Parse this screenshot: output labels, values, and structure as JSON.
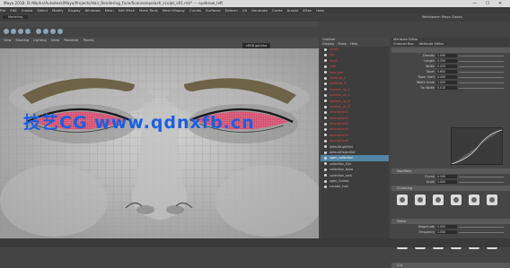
{
  "window": {
    "title": "Maya 2018: D:/Works/Autodesk/Maya/Projects/Hair_Rendering_Face/Scenes/eyelash_sculpt_v01.mb* --- eyebrow_left",
    "min": "—",
    "max": "☐",
    "close": "✕"
  },
  "menu": [
    "File",
    "Edit",
    "Create",
    "Select",
    "Modify",
    "Display",
    "Windows",
    "Mesh",
    "Edit Mesh",
    "Mesh Tools",
    "Mesh Display",
    "Curves",
    "Surfaces",
    "Deform",
    "UV",
    "Generate",
    "Cache",
    "Arnold",
    "XGen",
    "Help"
  ],
  "status": {
    "mode": "Modeling",
    "workspace": "Workspace: Maya Classic"
  },
  "viewport": {
    "menu": [
      "View",
      "Shading",
      "Lighting",
      "Show",
      "Renderer",
      "Panels"
    ],
    "camera_label": "sRGB gamma"
  },
  "outliner": {
    "title": "Outliner",
    "menu": [
      "Display",
      "Show",
      "Help"
    ],
    "items": [
      {
        "label": "persp",
        "color": "red"
      },
      {
        "label": "top",
        "color": "red"
      },
      {
        "label": "front",
        "color": "red"
      },
      {
        "label": "side",
        "color": "red"
      },
      {
        "label": "face_geo",
        "color": "red"
      },
      {
        "label": "eyebrow_L",
        "color": "red"
      },
      {
        "label": "eyebrow_R",
        "color": "red"
      },
      {
        "label": "eyelash_up_L",
        "color": "red"
      },
      {
        "label": "eyelash_dn_L",
        "color": "red"
      },
      {
        "label": "eyelash_up_R",
        "color": "red"
      },
      {
        "label": "eyelash_dn_R",
        "color": "red"
      },
      {
        "label": "description1",
        "color": "red"
      },
      {
        "label": "description2",
        "color": "red"
      },
      {
        "label": "description3",
        "color": "red"
      },
      {
        "label": "description4",
        "color": "red"
      },
      {
        "label": "description5",
        "color": "red"
      },
      {
        "label": "description6",
        "color": "red"
      },
      {
        "label": "defaultLightSet",
        "color": "none"
      },
      {
        "label": "defaultObjectSet",
        "color": "none"
      },
      {
        "label": "xgen_collection",
        "color": "sel"
      },
      {
        "label": "collection_Eye",
        "color": "none"
      },
      {
        "label": "collection_brow",
        "color": "none"
      },
      {
        "label": "collection_lash",
        "color": "none"
      },
      {
        "label": "xgen_Guides",
        "color": "none"
      },
      {
        "label": "Locator_hair",
        "color": "none"
      }
    ]
  },
  "attributes": {
    "title": "Attribute Editor",
    "tabs": [
      "Channel Box",
      "Attribute Editor"
    ],
    "rows": [
      {
        "label": "Density",
        "value": "1.000"
      },
      {
        "label": "Length",
        "value": "0.350"
      },
      {
        "label": "Width",
        "value": "0.020"
      },
      {
        "label": "Taper",
        "value": "0.600"
      },
      {
        "label": "Taper Start",
        "value": "0.000"
      },
      {
        "label": "Width Scale",
        "value": "1.000"
      },
      {
        "label": "Tip Width",
        "value": "0.010"
      }
    ],
    "section_modifiers": "Modifiers",
    "section_clumping": "Clumping",
    "section_noise": "Noise",
    "section_cut": "Cut",
    "rows2": [
      {
        "label": "Clump",
        "value": "0.500"
      },
      {
        "label": "Scale",
        "value": "1.000"
      }
    ],
    "rows3": [
      {
        "label": "Magnitude",
        "value": "0.000"
      },
      {
        "label": "Frequency",
        "value": "1.000"
      }
    ]
  },
  "watermark": "技艺CG www.qdnxfb.cn"
}
